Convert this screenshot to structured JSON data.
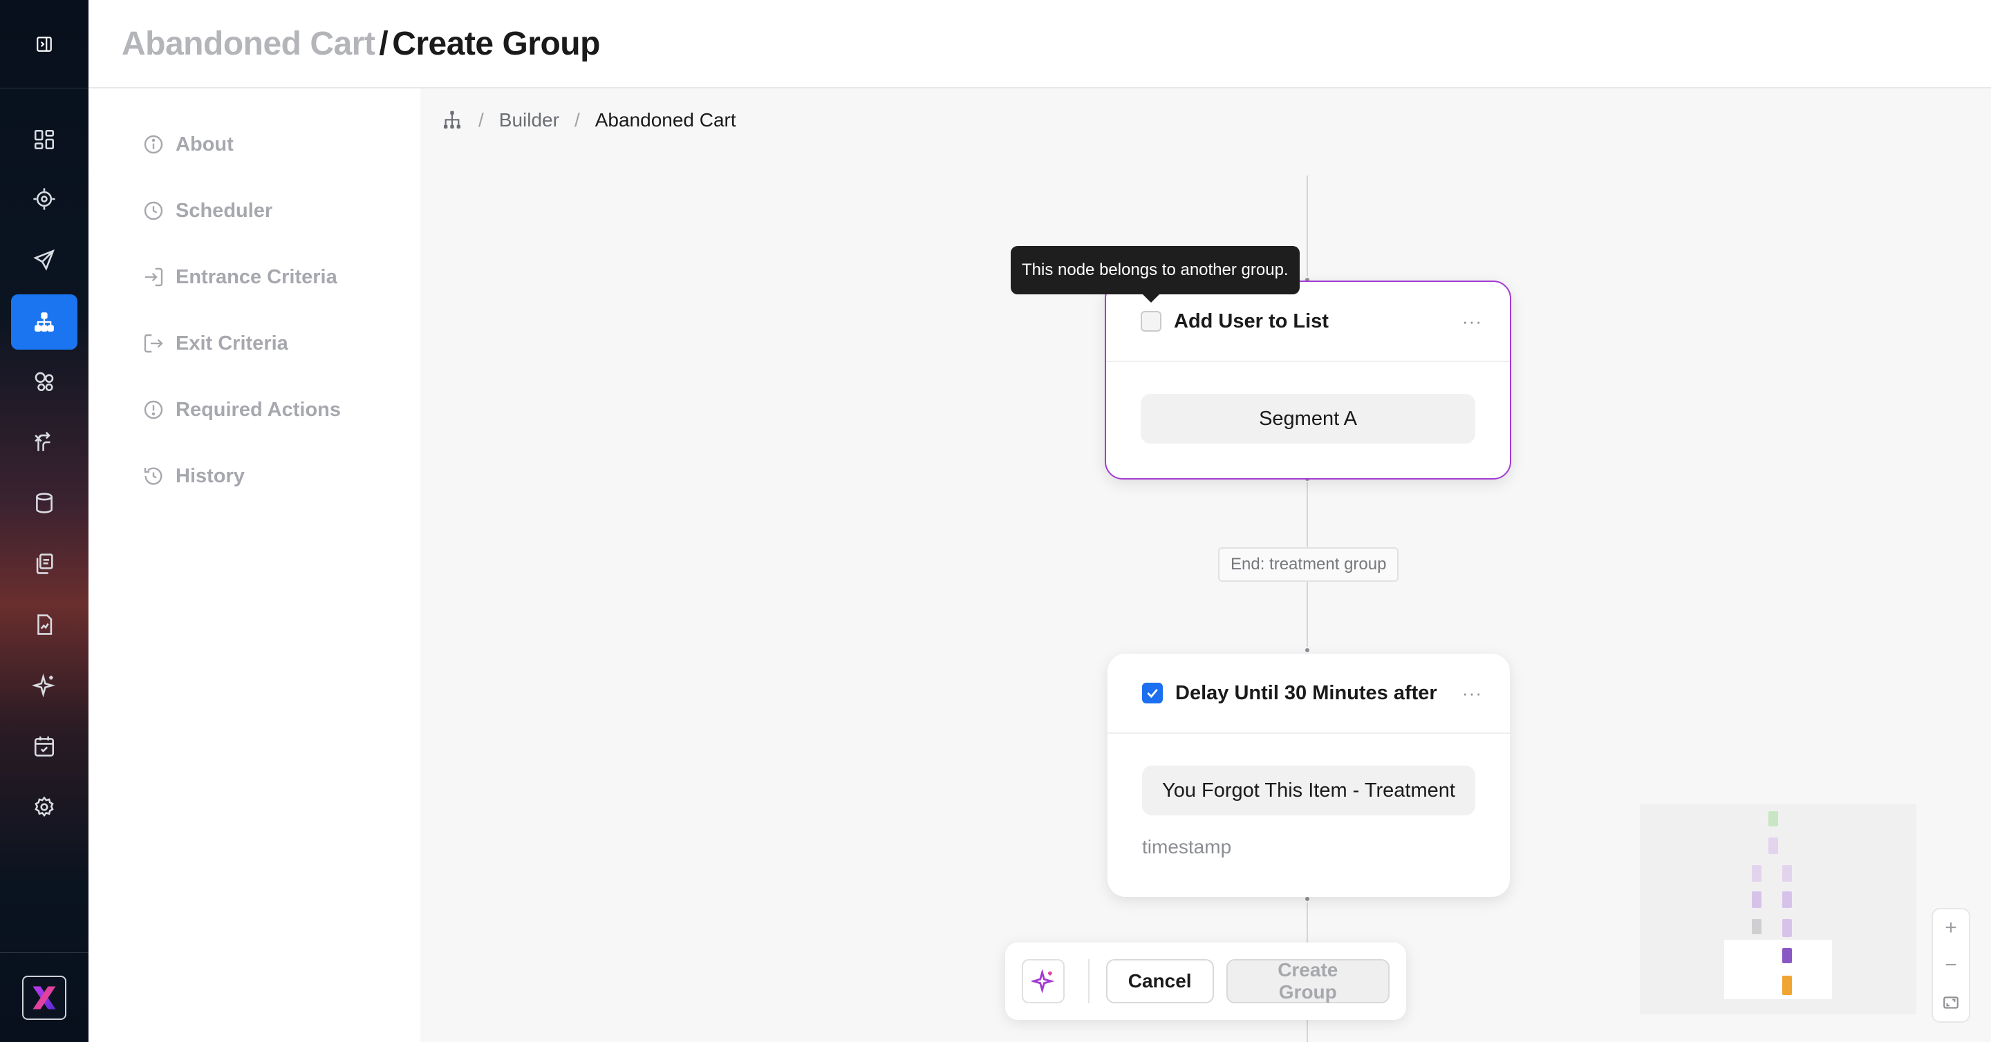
{
  "header": {
    "parent": "Abandoned Cart",
    "separator": "/",
    "current": "Create Group"
  },
  "rail": {
    "items": [
      {
        "icon": "dashboard-icon"
      },
      {
        "icon": "target-icon"
      },
      {
        "icon": "send-icon"
      },
      {
        "icon": "journey-builder-icon",
        "active": true
      },
      {
        "icon": "segments-icon"
      },
      {
        "icon": "routing-icon"
      },
      {
        "icon": "database-icon"
      },
      {
        "icon": "templates-icon"
      },
      {
        "icon": "reports-icon"
      },
      {
        "icon": "ai-sparkle-icon"
      },
      {
        "icon": "calendar-icon"
      },
      {
        "icon": "settings-icon"
      }
    ],
    "active_color": "#1b75f0"
  },
  "sidenav": {
    "items": [
      {
        "label": "About",
        "icon": "info-icon"
      },
      {
        "label": "Scheduler",
        "icon": "clock-icon"
      },
      {
        "label": "Entrance Criteria",
        "icon": "enter-icon"
      },
      {
        "label": "Exit Criteria",
        "icon": "exit-icon"
      },
      {
        "label": "Required Actions",
        "icon": "alert-icon"
      },
      {
        "label": "History",
        "icon": "history-icon"
      }
    ]
  },
  "breadcrumb": {
    "items": [
      "Builder",
      "Abandoned Cart"
    ],
    "separator": "/"
  },
  "flow": {
    "tooltip": "This node belongs to another group.",
    "node1": {
      "title": "Add User to List",
      "checked": false,
      "value": "Segment A",
      "border_color": "#a23bd3"
    },
    "edge_label": "End: treatment group",
    "node2": {
      "title": "Delay Until 30 Minutes after",
      "checked": true,
      "value": "You Forgot This Item - Treatment",
      "subtext": "timestamp"
    }
  },
  "actions": {
    "cancel_label": "Cancel",
    "create_label": "Create Group"
  },
  "zoom": {
    "in": "+",
    "out": "−"
  }
}
